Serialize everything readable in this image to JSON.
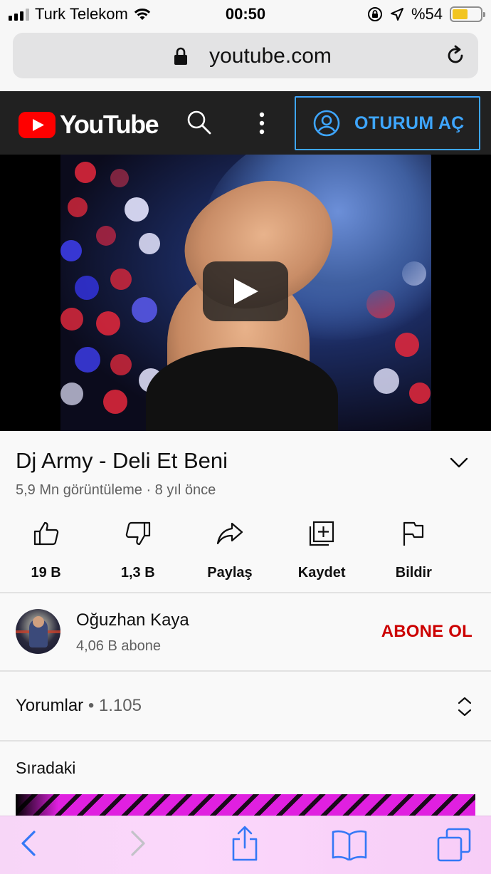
{
  "status_bar": {
    "carrier": "Turk Telekom",
    "time": "00:50",
    "battery_label": "%54",
    "battery_level": 0.54,
    "battery_color": "#f2c51f"
  },
  "browser": {
    "url": "youtube.com"
  },
  "youtube_header": {
    "logo_text": "YouTube",
    "signin_label": "OTURUM AÇ",
    "accent_color": "#3ea6ff",
    "logo_red": "#ff0000"
  },
  "video": {
    "title": "Dj Army - Deli Et Beni",
    "views_line": "5,9 Mn görüntüleme · 8 yıl önce"
  },
  "actions": [
    {
      "icon": "thumb-up-icon",
      "label": "19 B"
    },
    {
      "icon": "thumb-down-icon",
      "label": "1,3 B"
    },
    {
      "icon": "share-icon",
      "label": "Paylaş"
    },
    {
      "icon": "save-playlist-icon",
      "label": "Kaydet"
    },
    {
      "icon": "flag-icon",
      "label": "Bildir"
    }
  ],
  "channel": {
    "name": "Oğuzhan Kaya",
    "subscribers": "4,06 B abone",
    "subscribe_label": "ABONE OL",
    "subscribe_color": "#cc0000"
  },
  "comments": {
    "label": "Yorumlar",
    "count": "• 1.105"
  },
  "up_next": {
    "label": "Sıradaki"
  },
  "safari_toolbar": {
    "tint": "#3478f6",
    "items": [
      "back-icon",
      "forward-icon",
      "share-icon",
      "bookmarks-icon",
      "tabs-icon"
    ]
  }
}
